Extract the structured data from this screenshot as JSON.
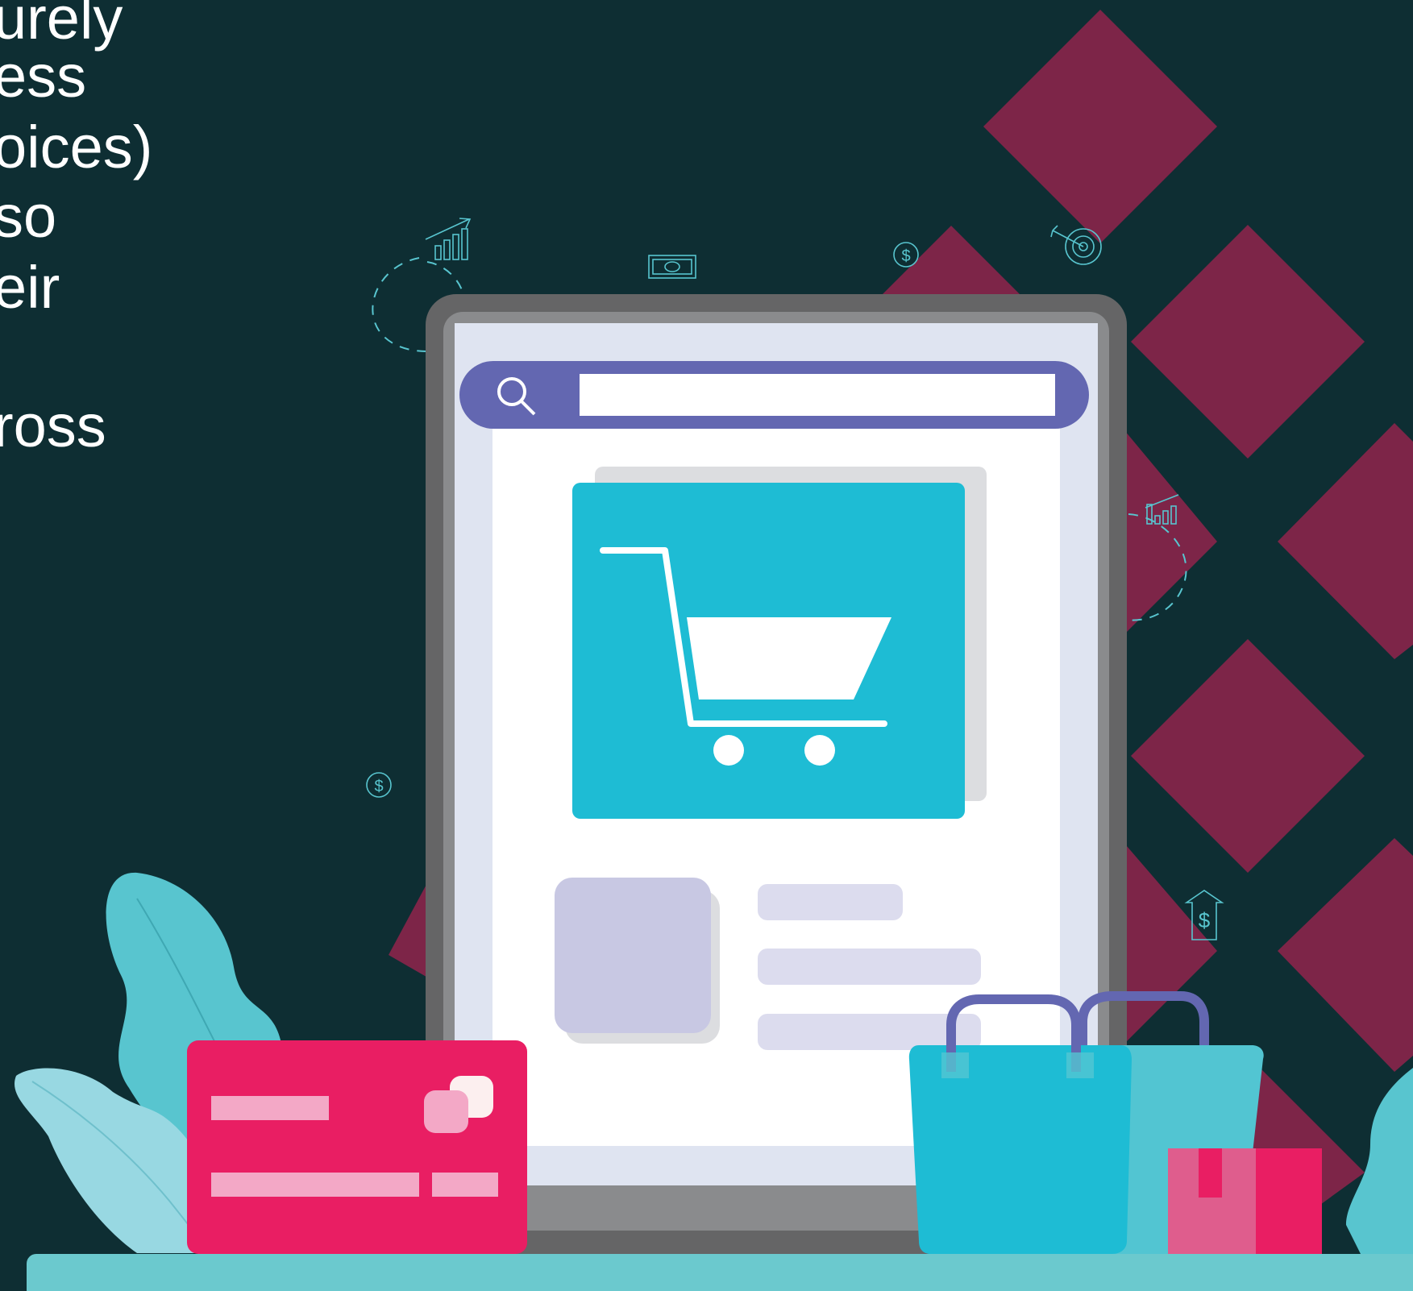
{
  "copy": {
    "lines": [
      "urely",
      "ess",
      "oices)",
      "so",
      "eir",
      "ross"
    ]
  },
  "search": {
    "value": "",
    "placeholder": ""
  },
  "icons": {
    "search": "magnifier-icon",
    "cart": "shopping-cart-icon",
    "card": "credit-card-icon",
    "bags": "shopping-bag-icon",
    "parcel": "parcel-box-icon",
    "growth": "bar-chart-growth-icon",
    "money": "banknote-icon",
    "coin": "dollar-coin-icon",
    "target": "target-arrow-icon",
    "home_price": "house-dollar-icon"
  },
  "colors": {
    "background": "#0e2e33",
    "diamond": "#7d2548",
    "tablet_frame": "#656566",
    "tablet_screen": "#dfe4f1",
    "search_bar": "#6367b1",
    "cart_tile": "#1ebcd4",
    "card": "#e91e63",
    "card_chip": "#f3a8c6",
    "bag_front": "#1ebcd4",
    "bag_back": "#52c5d2",
    "bag_handle": "#6367b1",
    "leaf": "#58c5cf",
    "ground": "#6bc9ce",
    "parcel": "#e91e63"
  }
}
